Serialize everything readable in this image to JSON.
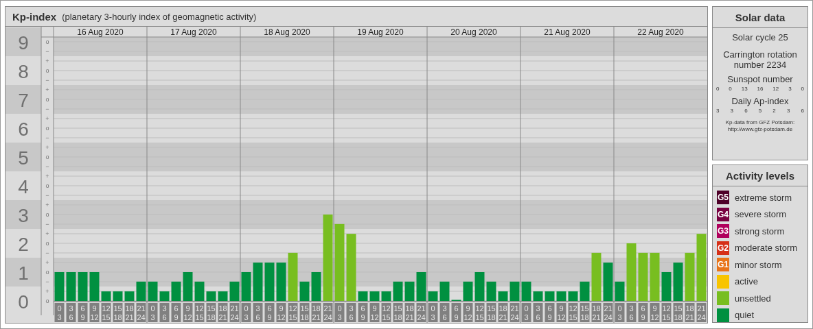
{
  "title": {
    "name": "Kp-index",
    "subtitle": "(planetary 3-hourly index of geomagnetic activity)"
  },
  "days": [
    "16 Aug 2020",
    "17 Aug 2020",
    "18 Aug 2020",
    "19 Aug 2020",
    "20 Aug 2020",
    "21 Aug 2020",
    "22 Aug 2020"
  ],
  "scale_marks": [
    "o",
    "−",
    "+",
    "o",
    "−",
    "+",
    "o",
    "−",
    "+",
    "o",
    "−",
    "+",
    "o",
    "−",
    "+",
    "o",
    "−",
    "+",
    "o",
    "−",
    "+",
    "o",
    "−",
    "+",
    "o",
    "−",
    "+",
    "o"
  ],
  "chart_data": {
    "type": "bar",
    "stacked": true,
    "grid": true,
    "categories": [
      "0\n3",
      "3\n6",
      "6\n9",
      "9\n12",
      "12\n15",
      "15\n18",
      "18\n21",
      "21\n24",
      "0\n3",
      "3\n6",
      "6\n9",
      "9\n12",
      "12\n15",
      "15\n18",
      "18\n21",
      "21\n24",
      "0\n3",
      "3\n6",
      "6\n9",
      "9\n12",
      "12\n15",
      "15\n18",
      "18\n21",
      "21\n24",
      "0\n3",
      "3\n6",
      "6\n9",
      "9\n12",
      "12\n15",
      "15\n18",
      "18\n21",
      "21\n24",
      "0\n3",
      "3\n6",
      "6\n9",
      "9\n12",
      "12\n15",
      "15\n18",
      "18\n21",
      "21\n24",
      "0\n3",
      "3\n6",
      "6\n9",
      "9\n12",
      "12\n15",
      "15\n18",
      "18\n21",
      "21\n24",
      "0\n3",
      "3\n6",
      "6\n9",
      "9\n12",
      "12\n15",
      "15\n18",
      "18\n21",
      "21\n24"
    ],
    "ylim": [
      0,
      9.5
    ],
    "yticks": [
      {
        "value": 0,
        "label": "0"
      },
      {
        "value": 1,
        "label": "1"
      },
      {
        "value": 2,
        "label": "2"
      },
      {
        "value": 3,
        "label": "3"
      },
      {
        "value": 4,
        "label": "4"
      },
      {
        "value": 5,
        "label": "5"
      },
      {
        "value": 6,
        "label": "6"
      },
      {
        "value": 7,
        "label": "7"
      },
      {
        "value": 8,
        "label": "8"
      },
      {
        "value": 9,
        "label": "9"
      }
    ],
    "series": [
      {
        "color": "#009040",
        "values": [
          1,
          1,
          1,
          1,
          0.33,
          0.33,
          0.33,
          0.67,
          0.67,
          0.33,
          0.67,
          1,
          0.67,
          0.33,
          0.33,
          0.67,
          1,
          1.33,
          1.33,
          1.33,
          null,
          0.67,
          1,
          null,
          null,
          null,
          0.33,
          0.33,
          0.33,
          0.67,
          0.67,
          1,
          0.33,
          0.67,
          0,
          0.67,
          1,
          0.67,
          0.33,
          0.67,
          0.67,
          0.33,
          0.33,
          0.33,
          0.33,
          0.67,
          null,
          1.33,
          0.67,
          null,
          null,
          null,
          1,
          1.33,
          null,
          null
        ]
      },
      {
        "color": "#78be20",
        "values": [
          null,
          null,
          null,
          null,
          null,
          null,
          null,
          null,
          null,
          null,
          null,
          null,
          null,
          null,
          null,
          null,
          null,
          null,
          null,
          null,
          1.67,
          null,
          null,
          3,
          2.67,
          2.33,
          null,
          null,
          null,
          null,
          null,
          null,
          null,
          null,
          null,
          null,
          null,
          null,
          null,
          null,
          null,
          null,
          null,
          null,
          null,
          null,
          1.67,
          null,
          null,
          2,
          1.67,
          1.67,
          null,
          null,
          1.67,
          2.33
        ]
      }
    ]
  },
  "solar_data": {
    "heading": "Solar data",
    "cycle": "Solar cycle 25",
    "rotation": [
      "Carrington rotation",
      "number 2234"
    ],
    "sunspot_heading": "Sunspot number",
    "sunspots": [
      "0",
      "0",
      "13",
      "16",
      "12",
      "3",
      "0"
    ],
    "ap_heading": "Daily Ap-index",
    "ap": [
      "3",
      "3",
      "6",
      "5",
      "2",
      "3",
      "6"
    ],
    "source": [
      "Kp-data from GFZ Potsdam:",
      "http://www.gfz-potsdam.de"
    ]
  },
  "activity_levels": {
    "heading": "Activity levels",
    "items": [
      {
        "badge": "G5",
        "label": "extreme storm",
        "color": "#4e0028"
      },
      {
        "badge": "G4",
        "label": "severe storm",
        "color": "#780040"
      },
      {
        "badge": "G3",
        "label": "strong storm",
        "color": "#b0005c"
      },
      {
        "badge": "G2",
        "label": "moderate storm",
        "color": "#d63018"
      },
      {
        "badge": "G1",
        "label": "minor storm",
        "color": "#e8741a"
      },
      {
        "label": "active",
        "color": "#f8c400"
      },
      {
        "label": "unsettled",
        "color": "#78be20"
      },
      {
        "label": "quiet",
        "color": "#009040"
      }
    ]
  }
}
